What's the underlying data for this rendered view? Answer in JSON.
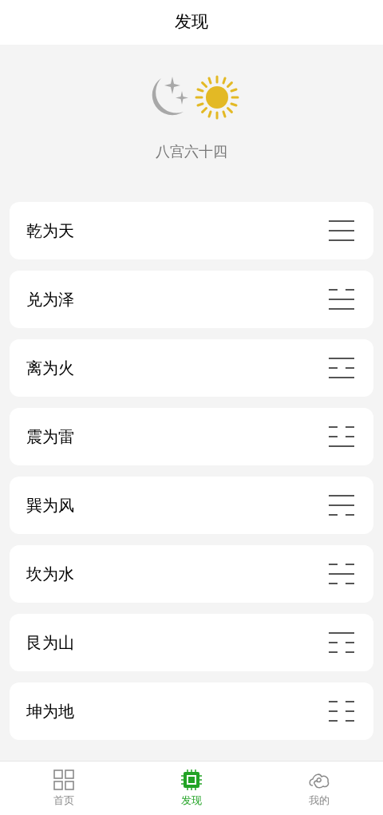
{
  "header": {
    "title": "发现"
  },
  "hero": {
    "subtitle": "八宫六十四"
  },
  "items": [
    {
      "label": "乾为天",
      "broken": [
        false,
        false,
        false
      ]
    },
    {
      "label": "兑为泽",
      "broken": [
        true,
        false,
        false
      ]
    },
    {
      "label": "离为火",
      "broken": [
        false,
        true,
        false
      ]
    },
    {
      "label": "震为雷",
      "broken": [
        true,
        true,
        false
      ]
    },
    {
      "label": "巽为风",
      "broken": [
        false,
        false,
        true
      ]
    },
    {
      "label": "坎为水",
      "broken": [
        true,
        false,
        true
      ]
    },
    {
      "label": "艮为山",
      "broken": [
        false,
        true,
        true
      ]
    },
    {
      "label": "坤为地",
      "broken": [
        true,
        true,
        true
      ]
    }
  ],
  "tabs": [
    {
      "label": "首页",
      "kind": "grid",
      "selected": false
    },
    {
      "label": "发现",
      "kind": "chip",
      "selected": true
    },
    {
      "label": "我的",
      "kind": "swirl",
      "selected": false
    }
  ]
}
